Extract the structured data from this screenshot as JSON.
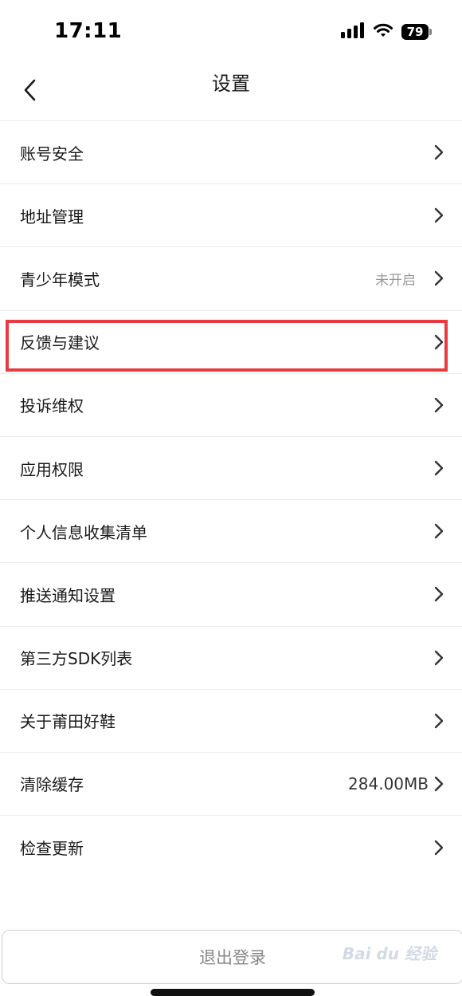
{
  "status_bar": {
    "time": "17:11",
    "battery": "79"
  },
  "header": {
    "title": "设置"
  },
  "settings": [
    {
      "label": "账号安全",
      "value": ""
    },
    {
      "label": "地址管理",
      "value": ""
    },
    {
      "label": "青少年模式",
      "value": "未开启"
    },
    {
      "label": "反馈与建议",
      "value": ""
    },
    {
      "label": "投诉维权",
      "value": ""
    },
    {
      "label": "应用权限",
      "value": ""
    },
    {
      "label": "个人信息收集清单",
      "value": ""
    },
    {
      "label": "推送通知设置",
      "value": ""
    },
    {
      "label": "第三方SDK列表",
      "value": ""
    },
    {
      "label": "关于莆田好鞋",
      "value": ""
    },
    {
      "label": "清除缓存",
      "value": "284.00MB"
    },
    {
      "label": "检查更新",
      "value": ""
    }
  ],
  "footer": {
    "logout_label": "退出登录"
  },
  "watermark": {
    "text": "Bai du 经验"
  },
  "colors": {
    "highlight": "#e93a3e",
    "divider": "#ececec",
    "muted_text": "#9a9a9a"
  }
}
